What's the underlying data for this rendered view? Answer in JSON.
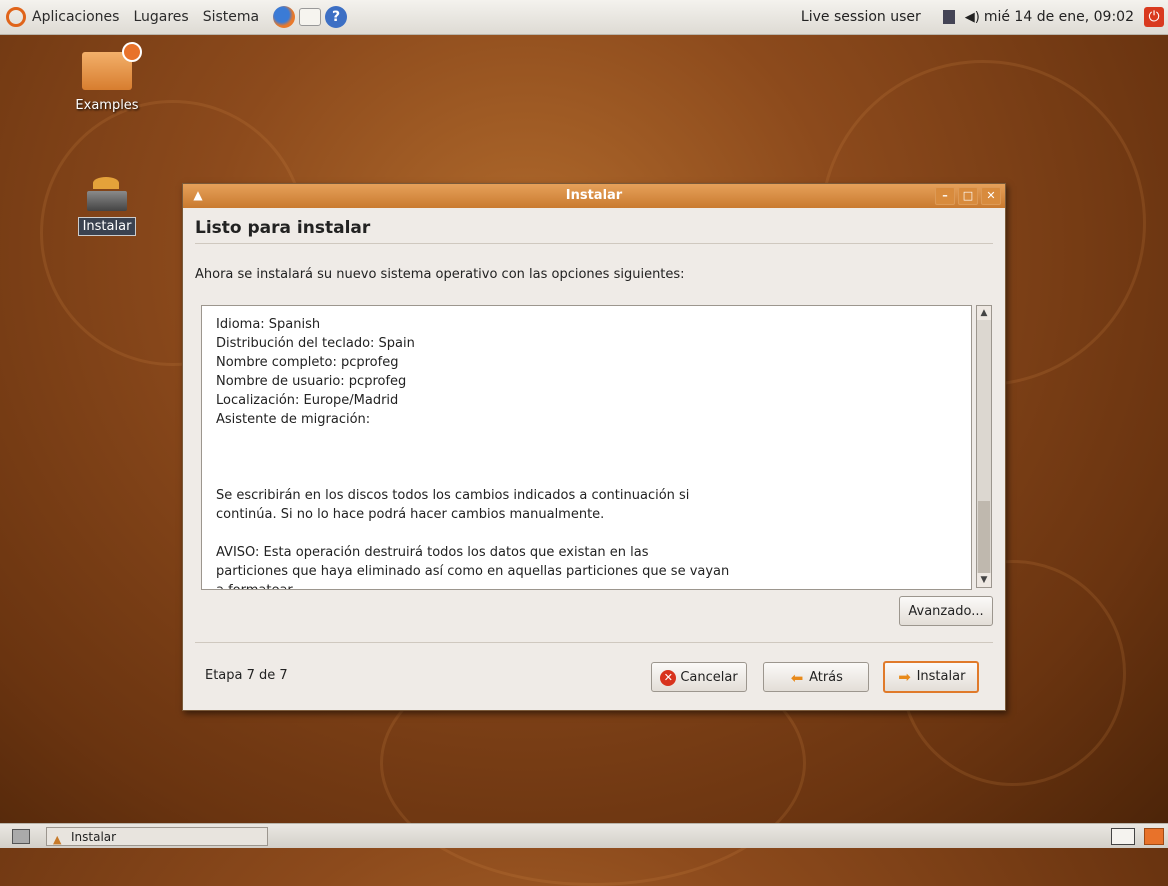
{
  "top_panel": {
    "menu": [
      "Aplicaciones",
      "Lugares",
      "Sistema"
    ],
    "icons": [
      "firefox-icon",
      "mail-icon",
      "help-icon"
    ],
    "user": "Live session user",
    "datetime": "mié 14 de ene, 09:02"
  },
  "desktop": {
    "icons": [
      {
        "label": "Examples"
      },
      {
        "label": "Instalar"
      }
    ]
  },
  "dialog": {
    "title": "Instalar",
    "heading": "Listo para instalar",
    "description": "Ahora se instalará su nuevo sistema operativo con las opciones siguientes:",
    "summary_lines": [
      "Idioma: Spanish",
      "Distribución del teclado: Spain",
      "Nombre completo: pcprofeg",
      "Nombre de usuario: pcprofeg",
      "Localización: Europe/Madrid",
      "Asistente de migración:"
    ],
    "paragraph1": [
      "Se escribirán en los discos todos los cambios indicados a continuación si",
      "continúa. Si no lo hace podrá hacer cambios manualmente."
    ],
    "paragraph2": [
      "AVISO: Esta operación destruirá todos los datos que existan en las",
      "particiones que haya eliminado así como en aquellas particiones que se vayan",
      "a formatear."
    ],
    "advanced_button": "Avanzado...",
    "stage": "Etapa 7 de 7",
    "cancel_button": "Cancelar",
    "back_button": "Atrás",
    "install_button": "Instalar"
  },
  "taskbar": {
    "task_label": "Instalar"
  },
  "colors": {
    "accent": "#e07a2a",
    "titlebar": "#d38a3f",
    "desktop": "#8c4a1c"
  }
}
